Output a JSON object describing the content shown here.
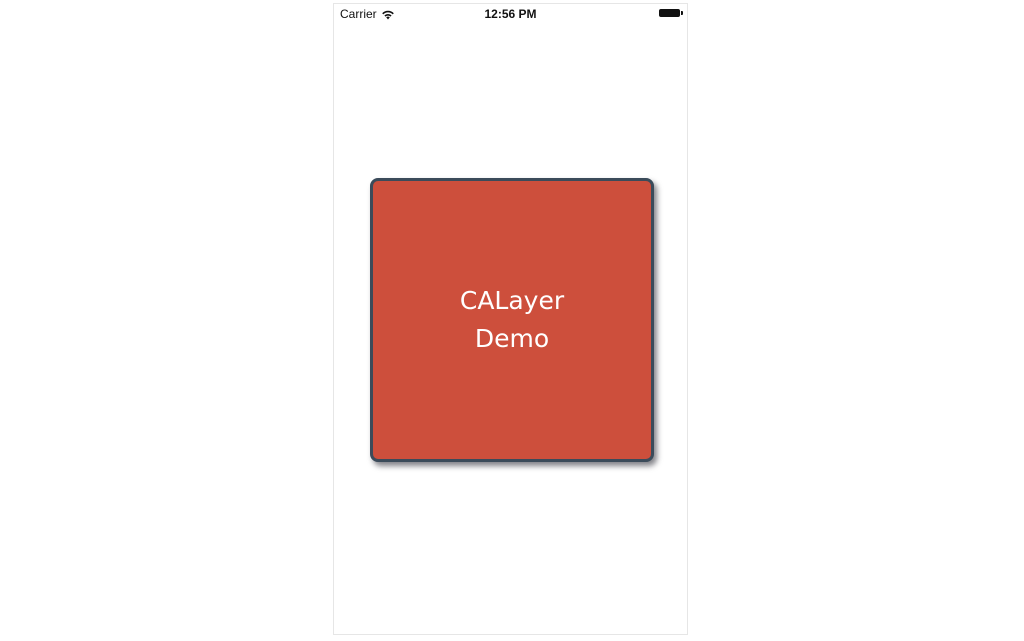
{
  "status_bar": {
    "carrier": "Carrier",
    "time": "12:56 PM",
    "wifi_icon": "wifi-icon",
    "battery_icon": "battery-icon"
  },
  "layer_view": {
    "line1": "CALayer",
    "line2": "Demo",
    "fill_color": "#cd4f3c",
    "border_color": "#3b4b5a",
    "text_color": "#ffffff"
  }
}
